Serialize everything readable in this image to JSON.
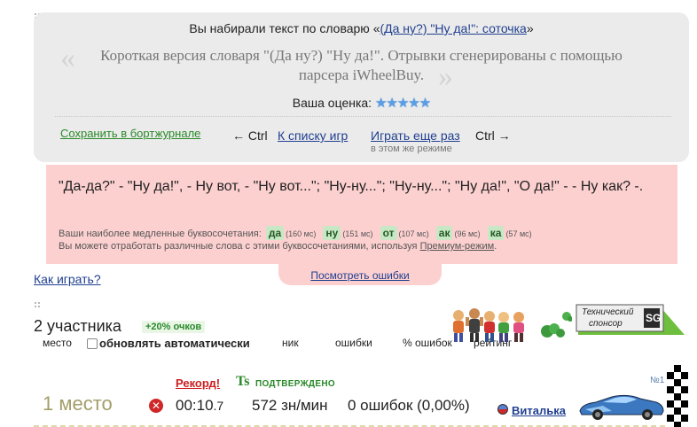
{
  "header": {
    "vocab_prefix": "Вы набирали текст по словарю «",
    "vocab_link": "(Да ну?) \"Ну да!\": соточка",
    "vocab_suffix": "»",
    "quote_open": "«",
    "quote_close": "»",
    "description": "Короткая версия словаря \"(Да ну?) \"Ну да!\". Отрывки сгенерированы с помощью парсера iWheelBuy.",
    "rating_label": "Ваша оценка:",
    "rating_stars": 5,
    "rating_star_glyph": "★★★★★"
  },
  "nav": {
    "save_label": "Сохранить в бортжурнале",
    "ctrl_left": "← Ctrl",
    "to_games": "К списку игр",
    "play_again": "Играть еще раз",
    "same_mode": "в этом же режиме",
    "ctrl_right": "Ctrl →"
  },
  "text_panel": {
    "typed_text": "\"Да-да?\" - \"Ну да!\", - Ну вот, - \"Ну вот...\"; \"Ну-ну...\"; \"Ну-ну...\"; \"Ну да!\", \"О да!\" - - Ну как? -.",
    "slow_label": "Ваши наиболее медленные буквосочетания:",
    "combos": [
      {
        "text": "да",
        "time": "(160 мс)"
      },
      {
        "text": "ну",
        "time": "(151 мс)"
      },
      {
        "text": "от",
        "time": "(107 мс)"
      },
      {
        "text": "ак",
        "time": "(96 мс)"
      },
      {
        "text": "ка",
        "time": "(57 мс)"
      }
    ],
    "practice_text": "Вы можете отработать различные слова с этими буквосочетаниями, используя ",
    "practice_link": "Премиум-режим",
    "practice_end": ".",
    "errors_link": "Посмотреть ошибки"
  },
  "how_to_play": "Как играть?",
  "participants": {
    "count_label": "2 участника",
    "bonus": "+20% очков",
    "columns": {
      "place": "место",
      "auto_update": "обновлять автоматически",
      "nick": "ник",
      "errors": "ошибки",
      "errors_pct": "% ошибок",
      "rating": "рейтинг"
    },
    "sponsor_line1": "Технический",
    "sponsor_line2": "спонсор",
    "sponsor_logo": "SG"
  },
  "result": {
    "record": "Рекорд!",
    "ts_icon": "Ts",
    "confirmed": "ПОДТВЕРЖДЕНО",
    "place": "1 место",
    "close_glyph": "✕",
    "time_main": "00:10",
    "time_ms": ".7",
    "speed": "572 зн/мин",
    "errors": "0 ошибок (0,00%)",
    "user": "Виталька",
    "car_number": "№1"
  },
  "colors": {
    "panel_grey": "#ebebeb",
    "panel_pink": "#fdd0d0",
    "link_blue": "#1f3f8f",
    "green": "#2a8a2a",
    "record_red": "#cc1f1f",
    "place_olive": "#a39e6a"
  }
}
